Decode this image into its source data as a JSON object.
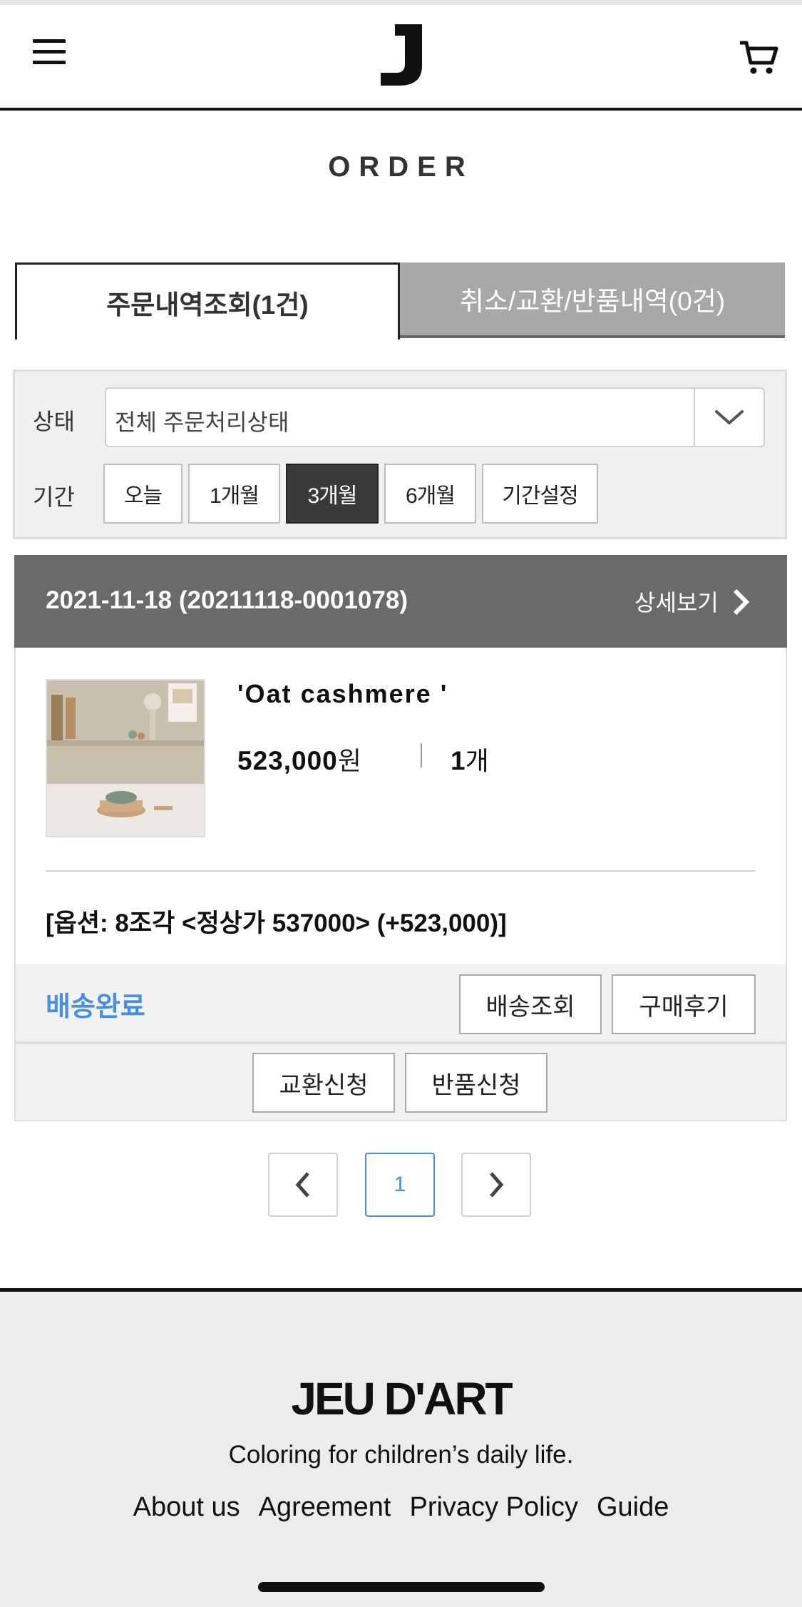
{
  "header": {
    "logo": "J",
    "menu_icon": "hamburger-menu-icon",
    "cart_icon": "shopping-cart-icon"
  },
  "page_title": "ORDER",
  "tabs": [
    {
      "label": "주문내역조회(1건)",
      "active": true
    },
    {
      "label": "취소/교환/반품내역(0건)",
      "active": false
    }
  ],
  "filter": {
    "status_label": "상태",
    "status_value": "전체 주문처리상태",
    "period_label": "기간",
    "periods": [
      {
        "label": "오늘",
        "active": false
      },
      {
        "label": "1개월",
        "active": false
      },
      {
        "label": "3개월",
        "active": true
      },
      {
        "label": "6개월",
        "active": false
      },
      {
        "label": "기간설정",
        "active": false
      }
    ]
  },
  "order": {
    "date_number": "2021-11-18 (20211118-0001078)",
    "detail_link": "상세보기",
    "product_name": "'Oat cashmere '",
    "price": "523,000",
    "currency": "원",
    "quantity": "1",
    "quantity_unit": "개",
    "option": "[옵션: 8조각 <정상가 537000> (+523,000)]",
    "status": "배송완료",
    "actions": [
      "배송조회",
      "구매후기"
    ],
    "returns": [
      "교환신청",
      "반품신청"
    ]
  },
  "pagination": {
    "current": "1",
    "prev_icon": "chevron-left-icon",
    "next_icon": "chevron-right-icon"
  },
  "footer": {
    "brand": "JEU D'ART",
    "tagline": "Coloring for children’s daily life.",
    "links": [
      "About us",
      "Agreement",
      "Privacy Policy",
      "Guide"
    ]
  },
  "colors": {
    "accent_blue": "#4a8ee0",
    "order_header": "#6a6a6a",
    "inactive_tab": "#a8a8a8"
  }
}
